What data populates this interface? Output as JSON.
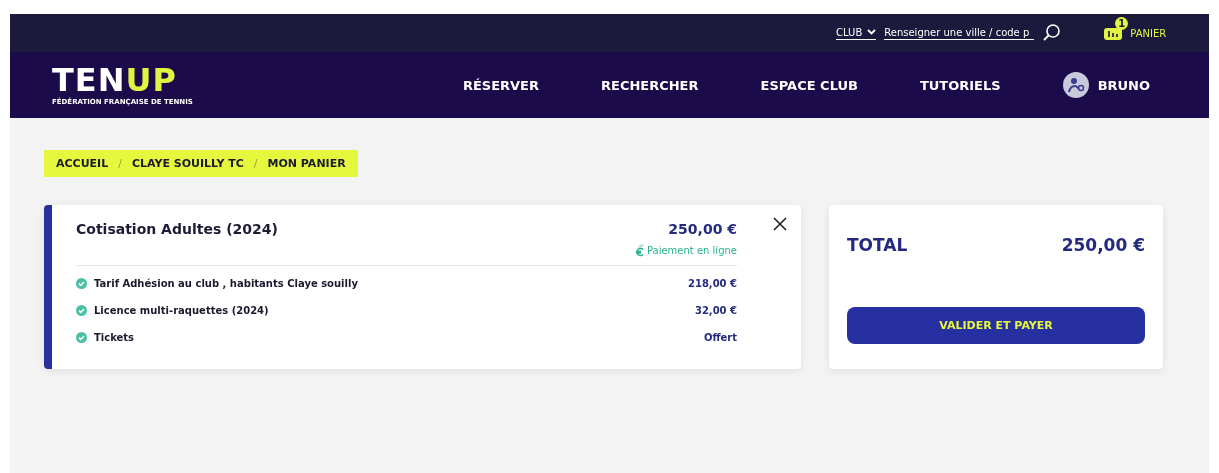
{
  "top_bar": {
    "club_select": "CLUB",
    "search": {
      "placeholder": "Renseigner une ville / code p"
    },
    "cart": {
      "count": "1",
      "label": "PANIER"
    }
  },
  "logo": {
    "left": "TEN",
    "right": "UP",
    "subtitle": "FÉDÉRATION FRANÇAISE DE TENNIS"
  },
  "nav": [
    "RÉSERVER",
    "RECHERCHER",
    "ESPACE CLUB",
    "TUTORIELS"
  ],
  "user": {
    "name": "BRUNO"
  },
  "breadcrumb": {
    "separator": "/",
    "items": [
      "ACCUEIL",
      "CLAYE SOUILLY TC",
      "MON PANIER"
    ]
  },
  "cart_item": {
    "title": "Cotisation Adultes (2024)",
    "price": "250,00 €",
    "payment": "Paiement en ligne",
    "lines": [
      {
        "label": "Tarif Adhésion au club , habitants Claye souilly",
        "price": "218,00 €"
      },
      {
        "label": "Licence multi-raquettes (2024)",
        "price": "32,00 €"
      },
      {
        "label": "Tickets",
        "price": "Offert"
      }
    ]
  },
  "summary": {
    "label": "TOTAL",
    "amount": "250,00 €",
    "button": "VALIDER ET PAYER"
  }
}
